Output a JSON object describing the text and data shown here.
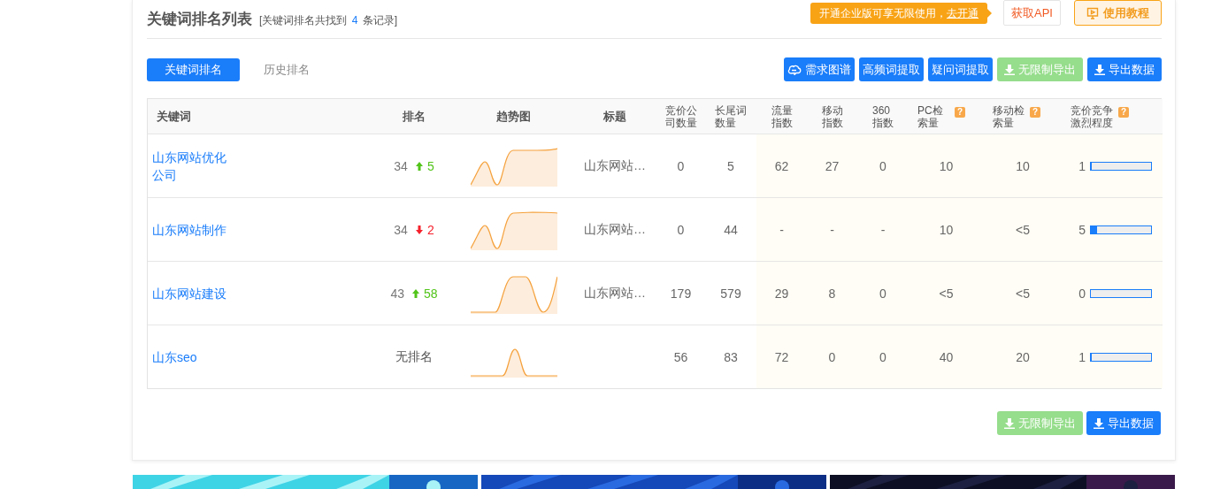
{
  "header": {
    "title": "关键词排名列表",
    "summary": {
      "prefix": "[关键词排名共找到",
      "count": "4",
      "suffix": "条记录]"
    },
    "promo": {
      "text": "开通企业版可享无限使用，",
      "link": "去开通"
    },
    "buttons": [
      {
        "label": "获取API",
        "kind": "outline"
      },
      {
        "label": "使用教程",
        "kind": "tutorial"
      }
    ]
  },
  "tabs": [
    {
      "label": "关键词排名",
      "selected": true
    },
    {
      "label": "历史排名",
      "selected": false
    }
  ],
  "toolbar": [
    {
      "label": "需求图谱",
      "kind": "graph",
      "disabled": false
    },
    {
      "label": "高频词提取",
      "kind": "plain",
      "disabled": false
    },
    {
      "label": "疑问词提取",
      "kind": "plain",
      "disabled": false
    },
    {
      "label": "无限制导出",
      "kind": "export",
      "disabled": true
    },
    {
      "label": "导出数据",
      "kind": "export",
      "disabled": false
    }
  ],
  "table": {
    "columns": [
      {
        "label": "关键词"
      },
      {
        "label": "排名"
      },
      {
        "label": "趋势图"
      },
      {
        "label": "标题"
      },
      {
        "label": "竞价公司数量"
      },
      {
        "label": "长尾词数量"
      },
      {
        "label": "流量指数"
      },
      {
        "label": "移动指数"
      },
      {
        "label": "360指数"
      },
      {
        "label": "PC检索量",
        "help": "?"
      },
      {
        "label": "移动检索量",
        "help": "?"
      },
      {
        "label": "竞价竞争激烈程度",
        "help": "?"
      }
    ],
    "rows": [
      {
        "cells": [
          "山东网站优化公司",
          {
            "rank": "34",
            "change": "5",
            "rising": true
          },
          {
            "kind": "picture"
          },
          "山东网站…",
          "0",
          "5",
          "62",
          "27",
          "0",
          "10",
          "10",
          {
            "reading": "1",
            "level": 0.02
          }
        ]
      },
      {
        "cells": [
          "山东网站制作",
          {
            "rank": "34",
            "change": "2",
            "rising": false
          },
          {
            "kind": "picture"
          },
          "山东网站…",
          "0",
          "44",
          "-",
          "-",
          "-",
          "10",
          "<5",
          {
            "reading": "5",
            "level": 0.1
          }
        ]
      },
      {
        "cells": [
          "山东网站建设",
          {
            "rank": "43",
            "change": "58",
            "rising": true
          },
          {
            "kind": "picture"
          },
          "山东网站…",
          "179",
          "579",
          "29",
          "8",
          "0",
          "<5",
          "<5",
          {
            "reading": "0",
            "level": 0
          }
        ]
      },
      {
        "cells": [
          "山东seo",
          {
            "rank": "无排名"
          },
          {
            "kind": "picture"
          },
          "",
          "56",
          "83",
          "72",
          "0",
          "0",
          "40",
          "20",
          {
            "reading": "1",
            "level": 0.02
          }
        ]
      }
    ]
  },
  "footer_buttons": [
    {
      "label": "无限制导出",
      "kind": "export",
      "disabled": true
    },
    {
      "label": "导出数据",
      "kind": "export",
      "disabled": false
    }
  ],
  "banners": [
    {
      "kind": "picture"
    },
    {
      "kind": "picture"
    },
    {
      "kind": "picture"
    }
  ]
}
